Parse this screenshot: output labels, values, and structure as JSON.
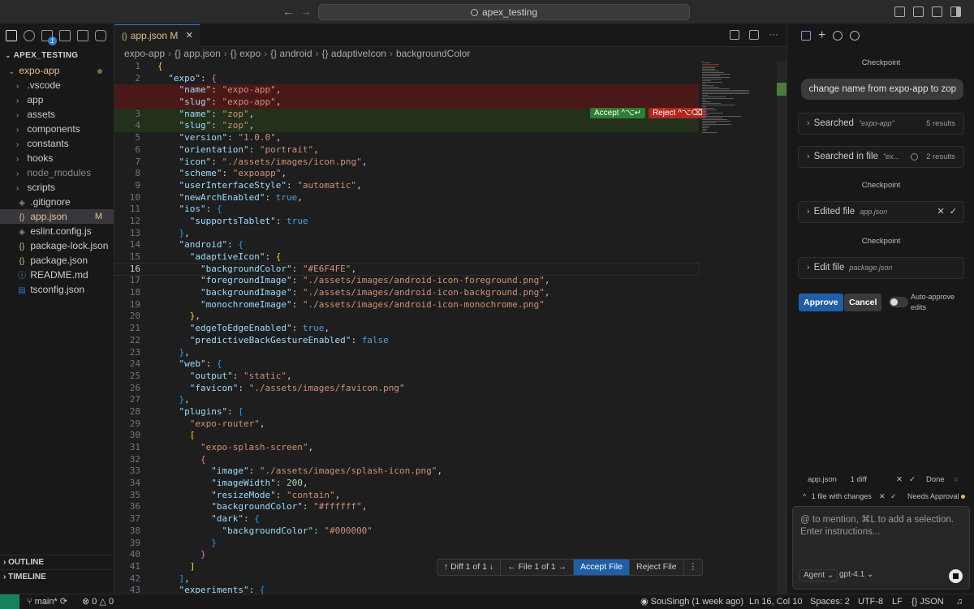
{
  "titlebar": {
    "search": "apex_testing",
    "back": "←",
    "forward": "→"
  },
  "sidebar": {
    "explorer_title": "APEX_TESTING",
    "items": [
      {
        "label": "expo-app",
        "type": "folder-open",
        "indent": 1
      },
      {
        "label": ".vscode",
        "type": "folder",
        "indent": 2
      },
      {
        "label": "app",
        "type": "folder",
        "indent": 2
      },
      {
        "label": "assets",
        "type": "folder",
        "indent": 2
      },
      {
        "label": "components",
        "type": "folder",
        "indent": 2
      },
      {
        "label": "constants",
        "type": "folder",
        "indent": 2
      },
      {
        "label": "hooks",
        "type": "folder",
        "indent": 2
      },
      {
        "label": "node_modules",
        "type": "folder",
        "indent": 2
      },
      {
        "label": "scripts",
        "type": "folder",
        "indent": 2
      },
      {
        "label": ".gitignore",
        "type": "file",
        "indent": 2
      },
      {
        "label": "app.json",
        "type": "json",
        "indent": 2,
        "mark": "M"
      },
      {
        "label": "eslint.config.js",
        "type": "file",
        "indent": 2
      },
      {
        "label": "package-lock.json",
        "type": "json",
        "indent": 2
      },
      {
        "label": "package.json",
        "type": "json",
        "indent": 2
      },
      {
        "label": "README.md",
        "type": "info",
        "indent": 2
      },
      {
        "label": "tsconfig.json",
        "type": "ts",
        "indent": 2
      }
    ],
    "outline": "OUTLINE",
    "timeline": "TIMELINE",
    "scm_badge": "1"
  },
  "editor": {
    "tab_label": "app.json",
    "tab_mark": "M",
    "breadcrumb": [
      "expo-app",
      "{} app.json",
      "{} expo",
      "{} android",
      "{} adaptiveIcon",
      "backgroundColor"
    ],
    "accept_inline": "Accept ^⌥↵",
    "reject_inline": "Reject ^⌥⌫",
    "diff_bar": {
      "diff": "Diff 1 of 1",
      "file": "File 1 of 1",
      "accept_file": "Accept File",
      "reject_file": "Reject File"
    }
  },
  "panel": {
    "checkpoint": "Checkpoint",
    "user_message": "change name from expo-app to zop",
    "steps": [
      {
        "label": "Searched",
        "query": "\"expo-app\"",
        "result": "5 results"
      },
      {
        "label": "Searched in file",
        "query": "\"ex...",
        "result": "2 results"
      },
      {
        "label": "Edited file",
        "query": "app.json"
      },
      {
        "label": "Edit file",
        "query": "package.json"
      }
    ],
    "approve": "Approve",
    "cancel": "Cancel",
    "auto_approve": "Auto-approve edits",
    "file_row": {
      "file": "app.json",
      "diffs": "1 diff",
      "status": "Done"
    },
    "changes_row": {
      "label": "1 file with changes",
      "status": "Needs Approval"
    },
    "input_placeholder": "@ to mention, ⌘L to add a selection. Enter instructions...",
    "agent": "Agent",
    "model": "gpt-4.1"
  },
  "statusbar": {
    "branch": "main*",
    "errors": "0",
    "warnings": "0",
    "blame": "SouSingh (1 week ago)",
    "position": "Ln 16, Col 10",
    "spaces": "Spaces: 2",
    "encoding": "UTF-8",
    "eol": "LF",
    "language": "JSON"
  },
  "colors": {
    "accent": "#2f7fd3",
    "removed": "#4b1818",
    "added": "#22301c",
    "accept": "#2e7d32",
    "reject": "#b3261e"
  },
  "code": [
    {
      "n": "1",
      "t": [
        [
          "br1",
          "{"
        ]
      ]
    },
    {
      "n": "2",
      "t": [
        [
          "p",
          "  "
        ],
        [
          "k",
          "\"expo\""
        ],
        [
          "p",
          ": "
        ],
        [
          "br2",
          "{"
        ]
      ]
    },
    {
      "n": "",
      "cls": "removed",
      "t": [
        [
          "p",
          "    "
        ],
        [
          "k",
          "\"name\""
        ],
        [
          "p",
          ": "
        ],
        [
          "s",
          "\"expo-app\""
        ],
        [
          "p",
          ","
        ]
      ]
    },
    {
      "n": "",
      "cls": "removed",
      "t": [
        [
          "p",
          "    "
        ],
        [
          "k",
          "\"slug\""
        ],
        [
          "p",
          ": "
        ],
        [
          "s",
          "\"expo-app\""
        ],
        [
          "p",
          ","
        ]
      ]
    },
    {
      "n": "3",
      "cls": "added",
      "t": [
        [
          "p",
          "    "
        ],
        [
          "k",
          "\"name\""
        ],
        [
          "p",
          ": "
        ],
        [
          "s",
          "\"zop\""
        ],
        [
          "p",
          ","
        ]
      ]
    },
    {
      "n": "4",
      "cls": "added",
      "t": [
        [
          "p",
          "    "
        ],
        [
          "k",
          "\"slug\""
        ],
        [
          "p",
          ": "
        ],
        [
          "s",
          "\"zop\""
        ],
        [
          "p",
          ","
        ]
      ]
    },
    {
      "n": "5",
      "t": [
        [
          "p",
          "    "
        ],
        [
          "k",
          "\"version\""
        ],
        [
          "p",
          ": "
        ],
        [
          "s",
          "\"1.0.0\""
        ],
        [
          "p",
          ","
        ]
      ]
    },
    {
      "n": "6",
      "t": [
        [
          "p",
          "    "
        ],
        [
          "k",
          "\"orientation\""
        ],
        [
          "p",
          ": "
        ],
        [
          "s",
          "\"portrait\""
        ],
        [
          "p",
          ","
        ]
      ]
    },
    {
      "n": "7",
      "t": [
        [
          "p",
          "    "
        ],
        [
          "k",
          "\"icon\""
        ],
        [
          "p",
          ": "
        ],
        [
          "s",
          "\"./assets/images/icon.png\""
        ],
        [
          "p",
          ","
        ]
      ]
    },
    {
      "n": "8",
      "t": [
        [
          "p",
          "    "
        ],
        [
          "k",
          "\"scheme\""
        ],
        [
          "p",
          ": "
        ],
        [
          "s",
          "\"expoapp\""
        ],
        [
          "p",
          ","
        ]
      ]
    },
    {
      "n": "9",
      "t": [
        [
          "p",
          "    "
        ],
        [
          "k",
          "\"userInterfaceStyle\""
        ],
        [
          "p",
          ": "
        ],
        [
          "s",
          "\"automatic\""
        ],
        [
          "p",
          ","
        ]
      ]
    },
    {
      "n": "10",
      "t": [
        [
          "p",
          "    "
        ],
        [
          "k",
          "\"newArchEnabled\""
        ],
        [
          "p",
          ": "
        ],
        [
          "b",
          "true"
        ],
        [
          "p",
          ","
        ]
      ]
    },
    {
      "n": "11",
      "t": [
        [
          "p",
          "    "
        ],
        [
          "k",
          "\"ios\""
        ],
        [
          "p",
          ": "
        ],
        [
          "br3",
          "{"
        ]
      ]
    },
    {
      "n": "12",
      "t": [
        [
          "p",
          "      "
        ],
        [
          "k",
          "\"supportsTablet\""
        ],
        [
          "p",
          ": "
        ],
        [
          "b",
          "true"
        ]
      ]
    },
    {
      "n": "13",
      "t": [
        [
          "p",
          "    "
        ],
        [
          "br3",
          "}"
        ],
        [
          "p",
          ","
        ]
      ]
    },
    {
      "n": "14",
      "t": [
        [
          "p",
          "    "
        ],
        [
          "k",
          "\"android\""
        ],
        [
          "p",
          ": "
        ],
        [
          "br3",
          "{"
        ]
      ]
    },
    {
      "n": "15",
      "t": [
        [
          "p",
          "      "
        ],
        [
          "k",
          "\"adaptiveIcon\""
        ],
        [
          "p",
          ": "
        ],
        [
          "br1",
          "{"
        ]
      ]
    },
    {
      "n": "16",
      "cls": "cur",
      "t": [
        [
          "p",
          "        "
        ],
        [
          "k",
          "\"backgroundColor\""
        ],
        [
          "p",
          ": "
        ],
        [
          "s",
          "\"#E6F4FE\""
        ],
        [
          "p",
          ","
        ]
      ]
    },
    {
      "n": "17",
      "t": [
        [
          "p",
          "        "
        ],
        [
          "k",
          "\"foregroundImage\""
        ],
        [
          "p",
          ": "
        ],
        [
          "s",
          "\"./assets/images/android-icon-foreground.png\""
        ],
        [
          "p",
          ","
        ]
      ]
    },
    {
      "n": "18",
      "t": [
        [
          "p",
          "        "
        ],
        [
          "k",
          "\"backgroundImage\""
        ],
        [
          "p",
          ": "
        ],
        [
          "s",
          "\"./assets/images/android-icon-background.png\""
        ],
        [
          "p",
          ","
        ]
      ]
    },
    {
      "n": "19",
      "t": [
        [
          "p",
          "        "
        ],
        [
          "k",
          "\"monochromeImage\""
        ],
        [
          "p",
          ": "
        ],
        [
          "s",
          "\"./assets/images/android-icon-monochrome.png\""
        ]
      ]
    },
    {
      "n": "20",
      "t": [
        [
          "p",
          "      "
        ],
        [
          "br1",
          "}"
        ],
        [
          "p",
          ","
        ]
      ]
    },
    {
      "n": "21",
      "t": [
        [
          "p",
          "      "
        ],
        [
          "k",
          "\"edgeToEdgeEnabled\""
        ],
        [
          "p",
          ": "
        ],
        [
          "b",
          "true"
        ],
        [
          "p",
          ","
        ]
      ]
    },
    {
      "n": "22",
      "t": [
        [
          "p",
          "      "
        ],
        [
          "k",
          "\"predictiveBackGestureEnabled\""
        ],
        [
          "p",
          ": "
        ],
        [
          "b",
          "false"
        ]
      ]
    },
    {
      "n": "23",
      "t": [
        [
          "p",
          "    "
        ],
        [
          "br3",
          "}"
        ],
        [
          "p",
          ","
        ]
      ]
    },
    {
      "n": "24",
      "t": [
        [
          "p",
          "    "
        ],
        [
          "k",
          "\"web\""
        ],
        [
          "p",
          ": "
        ],
        [
          "br3",
          "{"
        ]
      ]
    },
    {
      "n": "25",
      "t": [
        [
          "p",
          "      "
        ],
        [
          "k",
          "\"output\""
        ],
        [
          "p",
          ": "
        ],
        [
          "s",
          "\"static\""
        ],
        [
          "p",
          ","
        ]
      ]
    },
    {
      "n": "26",
      "t": [
        [
          "p",
          "      "
        ],
        [
          "k",
          "\"favicon\""
        ],
        [
          "p",
          ": "
        ],
        [
          "s",
          "\"./assets/images/favicon.png\""
        ]
      ]
    },
    {
      "n": "27",
      "t": [
        [
          "p",
          "    "
        ],
        [
          "br3",
          "}"
        ],
        [
          "p",
          ","
        ]
      ]
    },
    {
      "n": "28",
      "t": [
        [
          "p",
          "    "
        ],
        [
          "k",
          "\"plugins\""
        ],
        [
          "p",
          ": "
        ],
        [
          "br3",
          "["
        ]
      ]
    },
    {
      "n": "29",
      "t": [
        [
          "p",
          "      "
        ],
        [
          "s",
          "\"expo-router\""
        ],
        [
          "p",
          ","
        ]
      ]
    },
    {
      "n": "30",
      "t": [
        [
          "p",
          "      "
        ],
        [
          "br1",
          "["
        ]
      ]
    },
    {
      "n": "31",
      "t": [
        [
          "p",
          "        "
        ],
        [
          "s",
          "\"expo-splash-screen\""
        ],
        [
          "p",
          ","
        ]
      ]
    },
    {
      "n": "32",
      "t": [
        [
          "p",
          "        "
        ],
        [
          "br2",
          "{"
        ]
      ]
    },
    {
      "n": "33",
      "t": [
        [
          "p",
          "          "
        ],
        [
          "k",
          "\"image\""
        ],
        [
          "p",
          ": "
        ],
        [
          "s",
          "\"./assets/images/splash-icon.png\""
        ],
        [
          "p",
          ","
        ]
      ]
    },
    {
      "n": "34",
      "t": [
        [
          "p",
          "          "
        ],
        [
          "k",
          "\"imageWidth\""
        ],
        [
          "p",
          ": "
        ],
        [
          "n",
          "200"
        ],
        [
          "p",
          ","
        ]
      ]
    },
    {
      "n": "35",
      "t": [
        [
          "p",
          "          "
        ],
        [
          "k",
          "\"resizeMode\""
        ],
        [
          "p",
          ": "
        ],
        [
          "s",
          "\"contain\""
        ],
        [
          "p",
          ","
        ]
      ]
    },
    {
      "n": "36",
      "t": [
        [
          "p",
          "          "
        ],
        [
          "k",
          "\"backgroundColor\""
        ],
        [
          "p",
          ": "
        ],
        [
          "s",
          "\"#ffffff\""
        ],
        [
          "p",
          ","
        ]
      ]
    },
    {
      "n": "37",
      "t": [
        [
          "p",
          "          "
        ],
        [
          "k",
          "\"dark\""
        ],
        [
          "p",
          ": "
        ],
        [
          "br3",
          "{"
        ]
      ]
    },
    {
      "n": "38",
      "t": [
        [
          "p",
          "            "
        ],
        [
          "k",
          "\"backgroundColor\""
        ],
        [
          "p",
          ": "
        ],
        [
          "s",
          "\"#000000\""
        ]
      ]
    },
    {
      "n": "39",
      "t": [
        [
          "p",
          "          "
        ],
        [
          "br3",
          "}"
        ]
      ]
    },
    {
      "n": "40",
      "t": [
        [
          "p",
          "        "
        ],
        [
          "br2",
          "}"
        ]
      ]
    },
    {
      "n": "41",
      "t": [
        [
          "p",
          "      "
        ],
        [
          "br1",
          "]"
        ]
      ]
    },
    {
      "n": "42",
      "t": [
        [
          "p",
          "    "
        ],
        [
          "br3",
          "]"
        ],
        [
          "p",
          ","
        ]
      ]
    },
    {
      "n": "43",
      "t": [
        [
          "p",
          "    "
        ],
        [
          "k",
          "\"experiments\""
        ],
        [
          "p",
          ": "
        ],
        [
          "br3",
          "{"
        ]
      ]
    }
  ]
}
